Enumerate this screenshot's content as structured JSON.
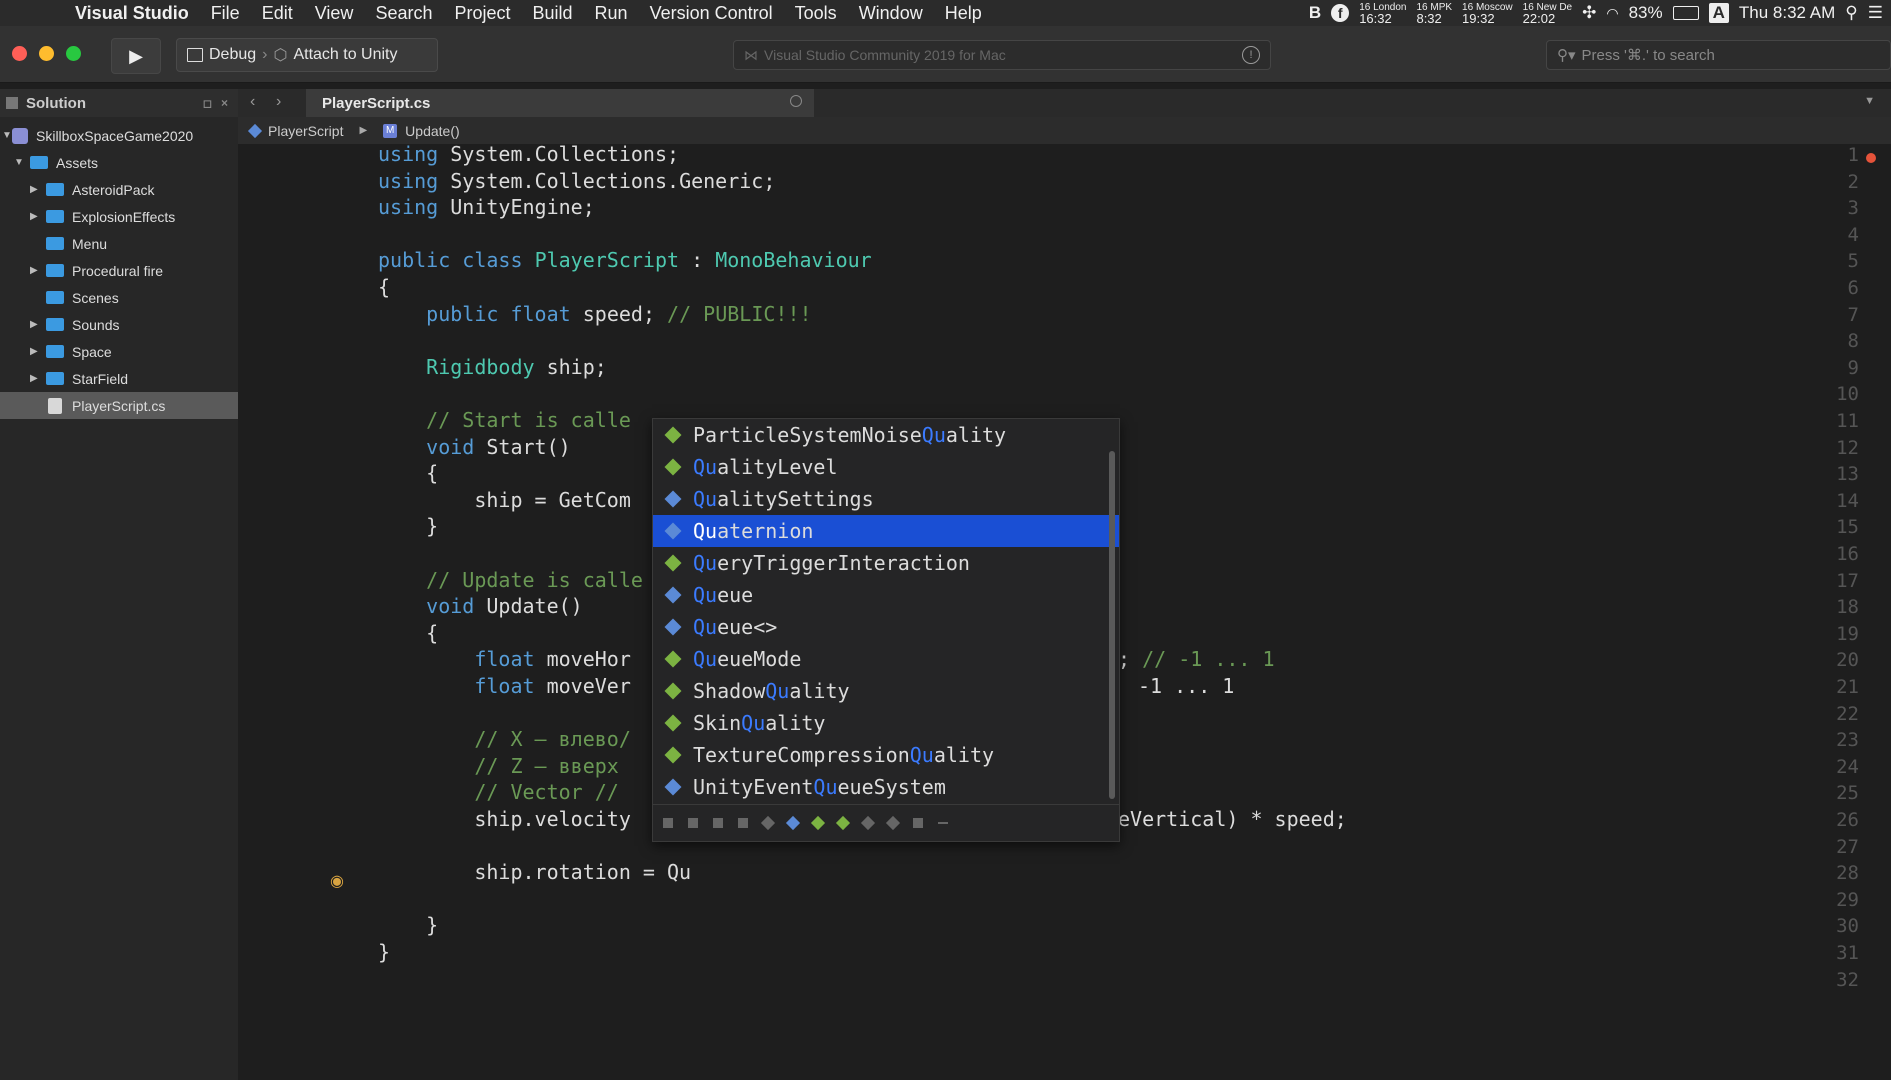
{
  "menubar": {
    "app": "Visual Studio",
    "items": [
      "File",
      "Edit",
      "View",
      "Search",
      "Project",
      "Build",
      "Run",
      "Version Control",
      "Tools",
      "Window",
      "Help"
    ],
    "clocks": [
      {
        "day": "16",
        "city": "London",
        "time": "16:32"
      },
      {
        "day": "16",
        "city": "MPK",
        "time": "8:32"
      },
      {
        "day": "16",
        "city": "Moscow",
        "time": "19:32"
      },
      {
        "day": "16",
        "city": "New De",
        "time": "22:02"
      }
    ],
    "battery": "83%",
    "input_source": "A",
    "datetime": "Thu 8:32 AM"
  },
  "toolbar": {
    "config": "Debug",
    "target": "Attach to Unity",
    "title": "Visual Studio Community 2019 for Mac",
    "search_placeholder": "Press '⌘.' to search"
  },
  "solution": {
    "title": "Solution",
    "items": [
      {
        "label": "SkillboxSpaceGame2020",
        "level": 0,
        "type": "solution",
        "expanded": true
      },
      {
        "label": "Assets",
        "level": 1,
        "type": "folder",
        "expanded": true
      },
      {
        "label": "AsteroidPack",
        "level": 2,
        "type": "folder",
        "expanded": false
      },
      {
        "label": "ExplosionEffects",
        "level": 2,
        "type": "folder",
        "expanded": false
      },
      {
        "label": "Menu",
        "level": 2,
        "type": "folder",
        "expanded": null
      },
      {
        "label": "Procedural fire",
        "level": 2,
        "type": "folder",
        "expanded": false
      },
      {
        "label": "Scenes",
        "level": 2,
        "type": "folder",
        "expanded": null
      },
      {
        "label": "Sounds",
        "level": 2,
        "type": "folder",
        "expanded": false
      },
      {
        "label": "Space",
        "level": 2,
        "type": "folder",
        "expanded": false
      },
      {
        "label": "StarField",
        "level": 2,
        "type": "folder",
        "expanded": false
      },
      {
        "label": "PlayerScript.cs",
        "level": 2,
        "type": "file",
        "selected": true
      }
    ]
  },
  "editor": {
    "tab": "PlayerScript.cs",
    "breadcrumb": [
      "PlayerScript",
      "Update()"
    ],
    "lines": [
      "using System.Collections;",
      "using System.Collections.Generic;",
      "using UnityEngine;",
      "",
      "public class PlayerScript : MonoBehaviour",
      "{",
      "    public float speed; // PUBLIC!!!",
      "",
      "    Rigidbody ship;",
      "",
      "    // Start is calle",
      "    void Start()",
      "    {",
      "        ship = GetCom",
      "    }",
      "",
      "    // Update is calle",
      "    void Update()",
      "    {",
      "        float moveHor",
      "        float moveVer",
      "",
      "        // X – влево/",
      "        // Z – вверх",
      "        // Vector //",
      "        ship.velocity",
      "",
      "        ship.rotation = Qu",
      "",
      "    }",
      "}",
      ""
    ],
    "right_fragments": [
      {
        "line": 20,
        "text": "; // -1 ... 1"
      },
      {
        "line": 21,
        "text": "-1 ... 1"
      },
      {
        "line": 26,
        "text": "eVertical) * speed;"
      }
    ]
  },
  "completion": {
    "selected_index": 3,
    "items": [
      {
        "pre": "ParticleSystemNoise",
        "match": "Qu",
        "post": "ality",
        "icon": "green"
      },
      {
        "pre": "",
        "match": "Qu",
        "post": "alityLevel",
        "icon": "green"
      },
      {
        "pre": "",
        "match": "Qu",
        "post": "alitySettings",
        "icon": "blue"
      },
      {
        "pre": "",
        "match": "Qu",
        "post": "aternion",
        "icon": "blue"
      },
      {
        "pre": "",
        "match": "Qu",
        "post": "eryTriggerInteraction",
        "icon": "green"
      },
      {
        "pre": "",
        "match": "Qu",
        "post": "eue",
        "icon": "blue"
      },
      {
        "pre": "",
        "match": "Qu",
        "post": "eue<>",
        "icon": "blue"
      },
      {
        "pre": "",
        "match": "Qu",
        "post": "eueMode",
        "icon": "green"
      },
      {
        "pre": "Shadow",
        "match": "Qu",
        "post": "ality",
        "icon": "green"
      },
      {
        "pre": "Skin",
        "match": "Qu",
        "post": "ality",
        "icon": "green"
      },
      {
        "pre": "TextureCompression",
        "match": "Qu",
        "post": "ality",
        "icon": "green"
      },
      {
        "pre": "UnityEvent",
        "match": "Qu",
        "post": "eueSystem",
        "icon": "blue"
      }
    ]
  },
  "colors": {
    "keyword": "#569cd6",
    "type": "#4ec9b0",
    "comment": "#6a9955",
    "selection": "#1a4fd4",
    "match": "#3b7bff"
  }
}
